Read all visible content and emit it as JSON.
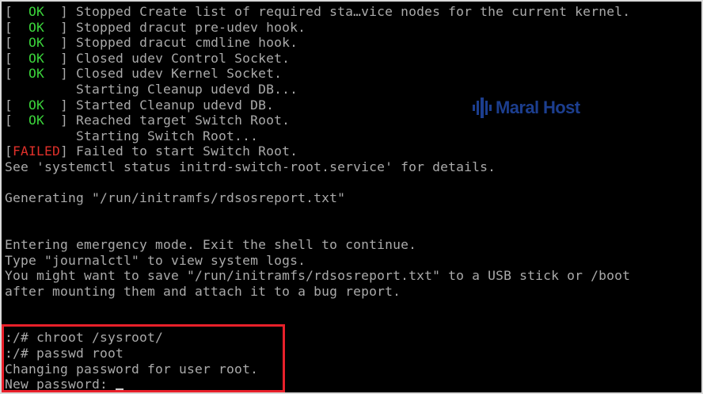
{
  "terminal": {
    "lines": [
      {
        "status": "  OK  ",
        "message": " Stopped Create list of required sta…vice nodes for the current kernel."
      },
      {
        "status": "  OK  ",
        "message": " Stopped dracut pre-udev hook."
      },
      {
        "status": "  OK  ",
        "message": " Stopped dracut cmdline hook."
      },
      {
        "status": "  OK  ",
        "message": " Closed udev Control Socket."
      },
      {
        "status": "  OK  ",
        "message": " Closed udev Kernel Socket."
      },
      {
        "text": "         Starting Cleanup udevd DB..."
      },
      {
        "status": "  OK  ",
        "message": " Started Cleanup udevd DB."
      },
      {
        "status": "  OK  ",
        "message": " Reached target Switch Root."
      },
      {
        "text": "         Starting Switch Root..."
      },
      {
        "status": "FAILED",
        "message": " Failed to start Switch Root."
      },
      {
        "text": "See 'systemctl status initrd-switch-root.service' for details."
      },
      {
        "text": ""
      },
      {
        "text": "Generating \"/run/initramfs/rdsosreport.txt\""
      },
      {
        "text": ""
      },
      {
        "text": ""
      },
      {
        "text": "Entering emergency mode. Exit the shell to continue."
      },
      {
        "text": "Type \"journalctl\" to view system logs."
      },
      {
        "text": "You might want to save \"/run/initramfs/rdsosreport.txt\" to a USB stick or /boot"
      },
      {
        "text": "after mounting them and attach it to a bug report."
      },
      {
        "text": ""
      },
      {
        "text": ""
      },
      {
        "text": ":/# chroot /sysroot/"
      },
      {
        "text": ":/# passwd root"
      },
      {
        "text": "Changing password for user root."
      }
    ],
    "prompt_label": "New password: "
  },
  "watermark": {
    "text": "Maral Host",
    "color": "#1c3e8f"
  },
  "colors": {
    "ok": "#3bd43b",
    "failed": "#e0302a",
    "text": "#aaaaaa",
    "highlight_border": "#e8202a"
  }
}
